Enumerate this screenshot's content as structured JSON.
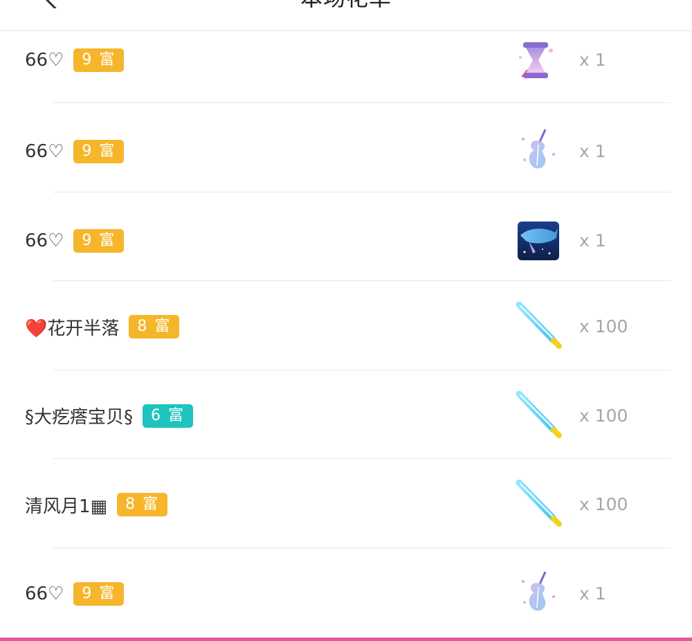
{
  "header": {
    "title": "本场花单",
    "back_icon": "chevron-left-icon"
  },
  "colors": {
    "badge_gold": "#f5b62b",
    "badge_teal": "#1ec4bd",
    "accent_bar": "#e8569a",
    "count_gray": "#a6a6a6"
  },
  "rows": [
    {
      "name": "66♡",
      "rich": "9 富",
      "badge_color": "#f5b62b",
      "gift_icon": "hourglass-gift-icon",
      "count": "x 1"
    },
    {
      "name": "66♡",
      "rich": "9 富",
      "badge_color": "#f5b62b",
      "gift_icon": "cello-gift-icon",
      "count": "x 1"
    },
    {
      "name": "66♡",
      "rich": "9 富",
      "badge_color": "#f5b62b",
      "gift_icon": "whale-gift-icon",
      "count": "x 1"
    },
    {
      "name": "❤️花开半落",
      "rich": "8 富",
      "badge_color": "#f5b62b",
      "gift_icon": "glowstick-gift-icon",
      "count": "x 100"
    },
    {
      "name": "§大疙瘩宝贝§",
      "rich": "6 富",
      "badge_color": "#1ec4bd",
      "gift_icon": "glowstick-gift-icon",
      "count": "x 100"
    },
    {
      "name": "清风月1▦",
      "rich": "8 富",
      "badge_color": "#f5b62b",
      "gift_icon": "glowstick-gift-icon",
      "count": "x 100"
    },
    {
      "name": "66♡",
      "rich": "9 富",
      "badge_color": "#f5b62b",
      "gift_icon": "cello-gift-icon",
      "count": "x 1"
    }
  ]
}
